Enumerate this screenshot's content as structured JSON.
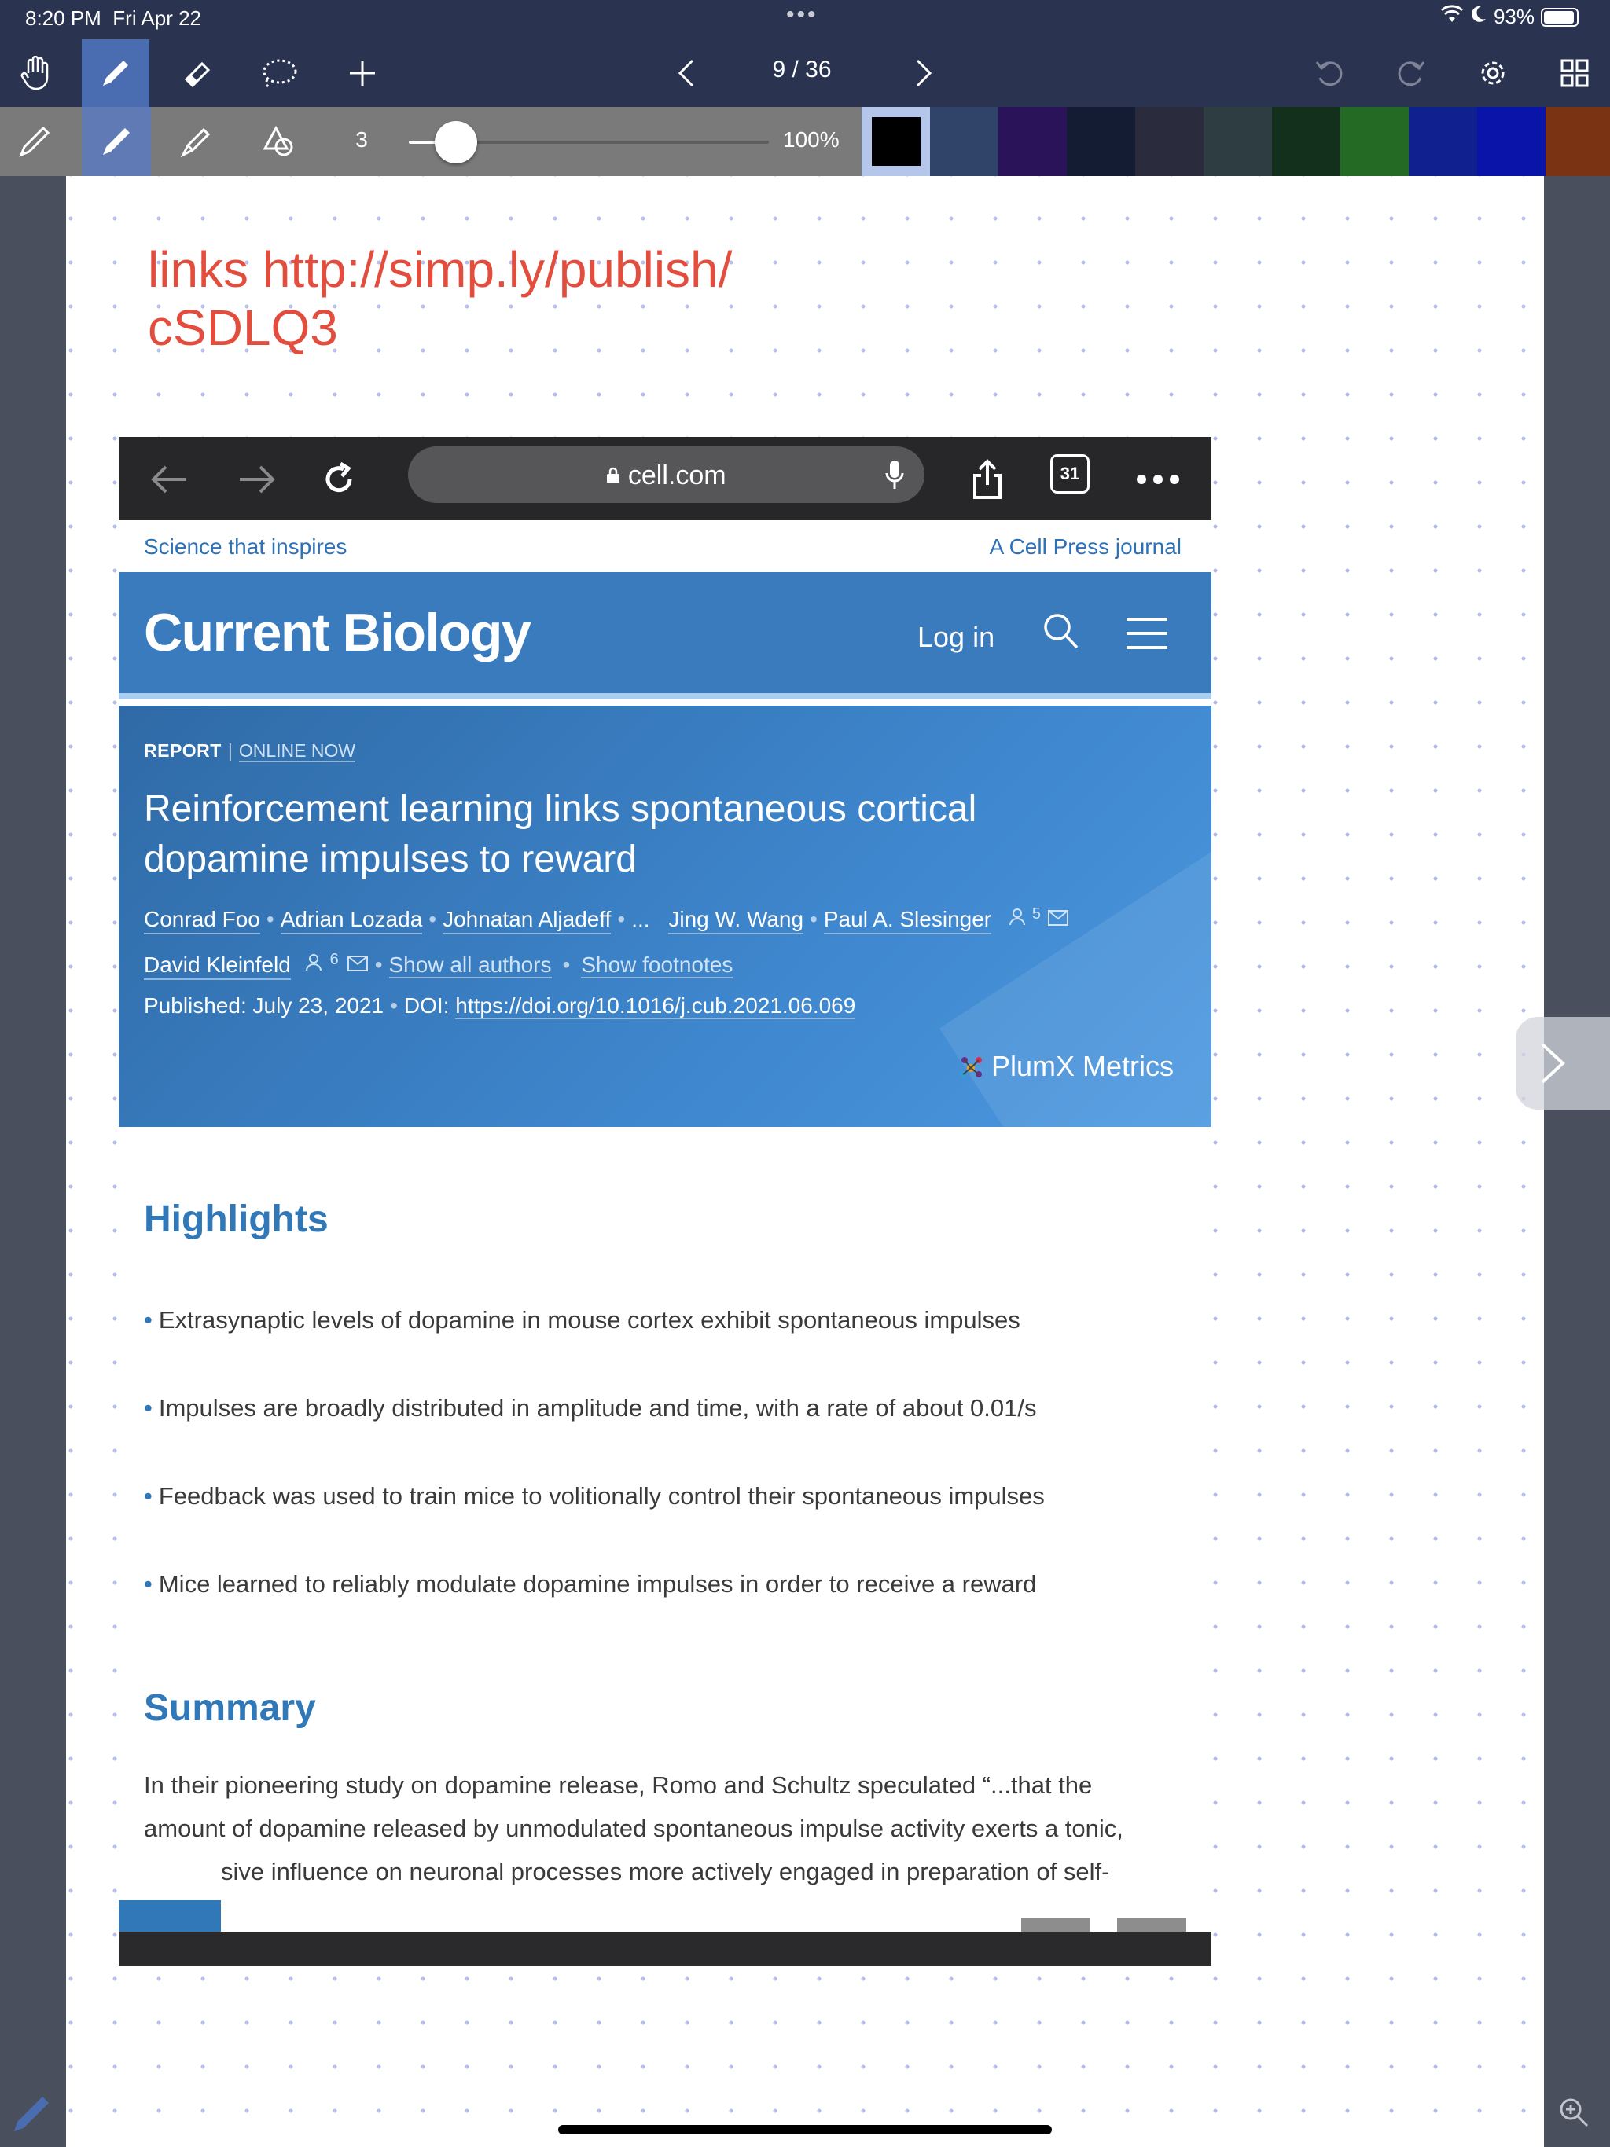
{
  "status_bar": {
    "time": "8:20 PM",
    "date": "Fri Apr 22",
    "battery": "93%"
  },
  "toolbar": {
    "page_indicator": "9 / 36"
  },
  "pen_toolbar": {
    "stroke_width": "3",
    "opacity": "100%",
    "stroke_width_fraction": 0.08,
    "swatches": [
      "#000000",
      "#2f4468",
      "#2a1358",
      "#141c34",
      "#2a2b3c",
      "#2e3d42",
      "#12301c",
      "#256a24",
      "#10208e",
      "#0a14a8",
      "#7a3414"
    ],
    "selected_swatch": 0
  },
  "note": {
    "line1": "links http://simp.ly/publish/",
    "line2": "cSDLQ3"
  },
  "browser": {
    "url": "cell.com",
    "tabs_count": "31"
  },
  "site": {
    "tagline": "Science that inspires",
    "journal_link": "A Cell Press journal",
    "journal_name": "Current Biology",
    "login": "Log in"
  },
  "article": {
    "type": "REPORT",
    "status": "ONLINE NOW",
    "title": "Reinforcement learning links spontaneous cortical dopamine impulses to reward",
    "authors": [
      "Conrad Foo",
      "Adrian Lozada",
      "Johnatan Aljadeff",
      "...",
      "Jing W. Wang",
      "Paul A. Slesinger"
    ],
    "ellipsis": "...",
    "slesinger_sup": "5",
    "last_author": "David Kleinfeld",
    "kleinfeld_sup": "6",
    "show_all_authors": "Show all authors",
    "show_footnotes": "Show footnotes",
    "published_label": "Published: July 23, 2021",
    "doi_label": "DOI:",
    "doi": "https://doi.org/10.1016/j.cub.2021.06.069",
    "plumx": "PlumX Metrics"
  },
  "highlights": {
    "heading": "Highlights",
    "items": [
      "Extrasynaptic levels of dopamine in mouse cortex exhibit spontaneous impulses",
      "Impulses are broadly distributed in amplitude and time, with a rate of about 0.01/s",
      "Feedback was used to train mice to volitionally control their spontaneous impulses",
      "Mice learned to reliably modulate dopamine impulses in order to receive a reward"
    ]
  },
  "summary": {
    "heading": "Summary",
    "line1": "In their pioneering study on dopamine release, Romo and Schultz speculated “...that the",
    "line2": "amount of dopamine released by unmodulated spontaneous impulse activity exerts a tonic,",
    "line3": "sive influence on neuronal processes more actively engaged in preparation of self-"
  }
}
